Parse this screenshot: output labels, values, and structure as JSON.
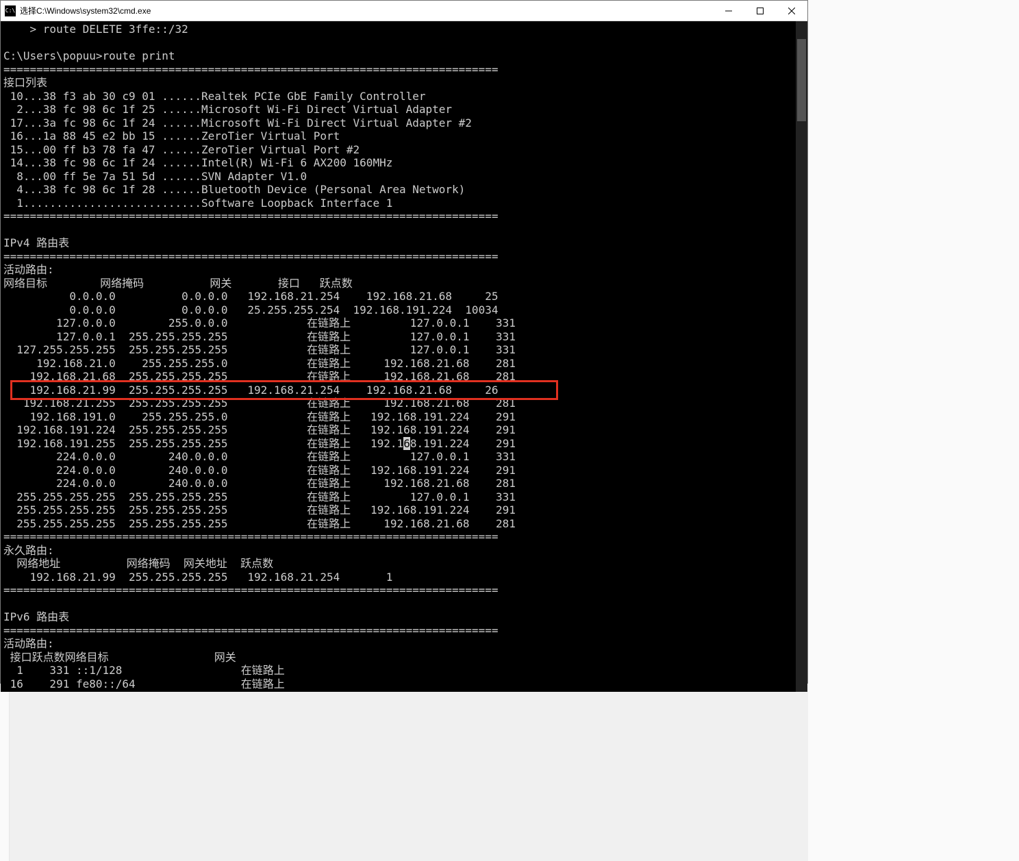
{
  "window": {
    "title": "选择C:\\Windows\\system32\\cmd.exe"
  },
  "console": {
    "prompt_line": "    > route DELETE 3ffe::/32",
    "command_line": "C:\\Users\\popuu>route print",
    "divider": "===========================================================================",
    "interface_list": {
      "header": "接口列表",
      "rows": [
        " 10...38 f3 ab 30 c9 01 ......Realtek PCIe GbE Family Controller",
        "  2...38 fc 98 6c 1f 25 ......Microsoft Wi-Fi Direct Virtual Adapter",
        " 17...3a fc 98 6c 1f 24 ......Microsoft Wi-Fi Direct Virtual Adapter #2",
        " 16...1a 88 45 e2 bb 15 ......ZeroTier Virtual Port",
        " 15...00 ff b3 78 fa 47 ......ZeroTier Virtual Port #2",
        " 14...38 fc 98 6c 1f 24 ......Intel(R) Wi-Fi 6 AX200 160MHz",
        "  8...00 ff 5e 7a 51 5d ......SVN Adapter V1.0",
        "  4...38 fc 98 6c 1f 28 ......Bluetooth Device (Personal Area Network)",
        "  1...........................Software Loopback Interface 1"
      ]
    },
    "ipv4": {
      "title": "IPv4 路由表",
      "active_routes": {
        "header": "活动路由:",
        "columns": "网络目标        网络掩码          网关       接口   跃点数",
        "rows": [
          "          0.0.0.0          0.0.0.0   192.168.21.254    192.168.21.68     25",
          "          0.0.0.0          0.0.0.0   25.255.255.254  192.168.191.224  10034",
          "        127.0.0.0        255.0.0.0            在链路上         127.0.0.1    331",
          "        127.0.0.1  255.255.255.255            在链路上         127.0.0.1    331",
          "  127.255.255.255  255.255.255.255            在链路上         127.0.0.1    331",
          "     192.168.21.0    255.255.255.0            在链路上     192.168.21.68    281",
          "    192.168.21.68  255.255.255.255            在链路上     192.168.21.68    281",
          "    192.168.21.99  255.255.255.255   192.168.21.254    192.168.21.68     26",
          "   192.168.21.255  255.255.255.255            在链路上     192.168.21.68    281",
          "    192.168.191.0    255.255.255.0            在链路上   192.168.191.224    291",
          "  192.168.191.224  255.255.255.255            在链路上   192.168.191.224    291",
          "  192.168.191.255  255.255.255.255            在链路上   192.168.191.224    291",
          "        224.0.0.0        240.0.0.0            在链路上         127.0.0.1    331",
          "        224.0.0.0        240.0.0.0            在链路上   192.168.191.224    291",
          "        224.0.0.0        240.0.0.0            在链路上     192.168.21.68    281",
          "  255.255.255.255  255.255.255.255            在链路上         127.0.0.1    331",
          "  255.255.255.255  255.255.255.255            在链路上   192.168.191.224    291",
          "  255.255.255.255  255.255.255.255            在链路上     192.168.21.68    281"
        ],
        "highlight_row_index": 7,
        "cursor_row_index": 11,
        "cursor_col": 58
      },
      "persistent": {
        "header": "永久路由:",
        "columns": "  网络地址          网络掩码  网关地址  跃点数",
        "row": "    192.168.21.99  255.255.255.255   192.168.21.254       1"
      }
    },
    "ipv6": {
      "title": "IPv6 路由表",
      "active_routes": {
        "header": "活动路由:",
        "columns": " 接口跃点数网络目标                网关",
        "rows": [
          "  1    331 ::1/128                  在链路上",
          " 16    291 fe80::/64                在链路上"
        ]
      }
    }
  }
}
